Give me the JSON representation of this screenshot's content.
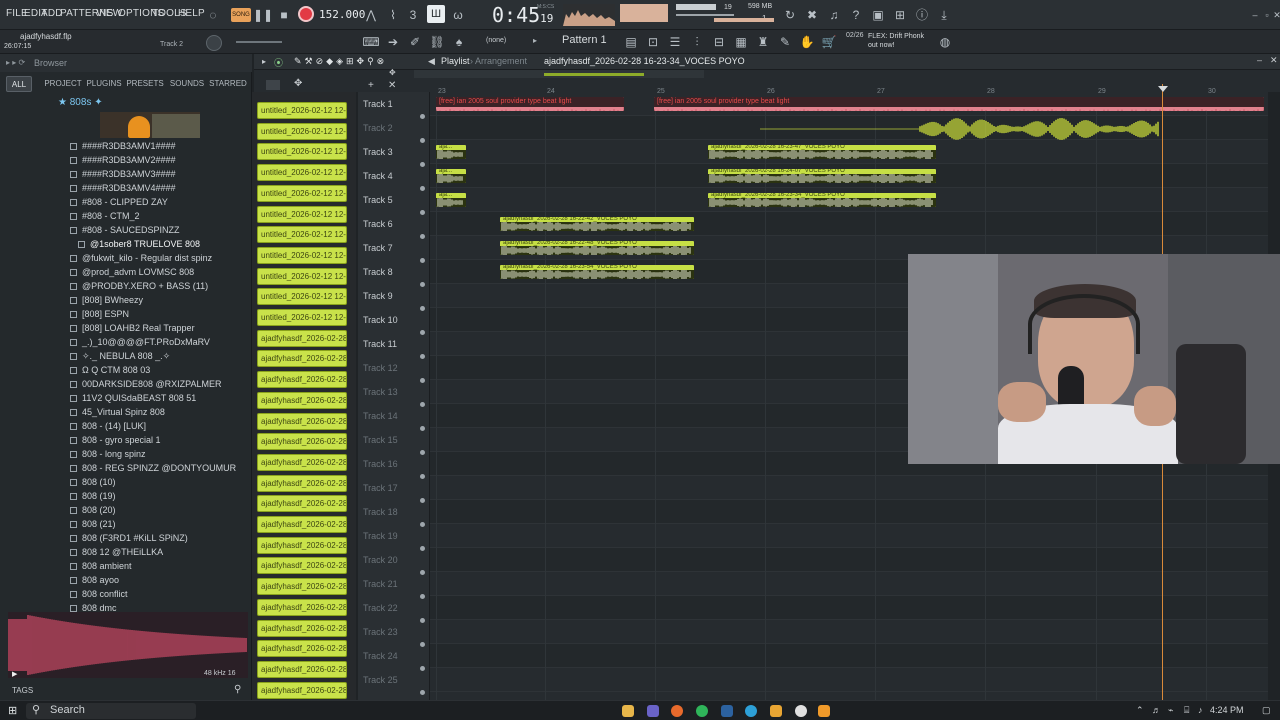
{
  "menu": [
    "FILE",
    "EDIT",
    "ADD",
    "PATTERNS",
    "VIEW",
    "OPTIONS",
    "TOOLS",
    "HELP"
  ],
  "transport": {
    "mode": "SONG",
    "tempo": "152.000",
    "time_main": "0:45",
    "time_sub": "19",
    "time_label": "M:S:CS",
    "memory": "598 MB",
    "cpu": "19",
    "voices": "1"
  },
  "project": {
    "filename": "ajadfyhasdf.flp",
    "elapsed": "26:07:15",
    "hint_track": "Track 2"
  },
  "bar2": {
    "pattern_label": "Pattern 1",
    "none_label": "(none)",
    "news_date": "02/26",
    "news_text": "FLEX: Drift Phonk out now!"
  },
  "browser": {
    "title": "Browser",
    "tabs": [
      "ALL",
      "PROJECT",
      "PLUGINS",
      "PRESETS",
      "SOUNDS",
      "STARRED"
    ],
    "folder": "808s",
    "items": [
      "####R3DB3AMV1####",
      "####R3DB3AMV2####",
      "####R3DB3AMV3####",
      "####R3DB3AMV4####",
      "#808 - CLIPPED ZAY",
      "#808 - CTM_2",
      "#808 - SAUCEDSPINZZ",
      "@1sober8 TRUELOVE 808",
      "@fukwit_kilo - Regular dist spinz",
      "@prod_advm LOVMSC 808",
      "@PRODBY.XERO + BASS (11)",
      "[808] BWheezy",
      "[808] ESPN",
      "[808] LOAHB2 Real Trapper",
      "_.)_10@@@@FT.PRoDxMaRV",
      "✧._ NEBULA 808 _.✧",
      "Ω Q CTM 808 03",
      "00DARKSIDE808 @RXIZPALMER",
      "11V2 QUISdaBEAST 808 51",
      "45_Virtual Spinz 808",
      "808 - (14) [LUK]",
      "808 - gyro special 1",
      "808 - long spinz",
      "808 - REG SPINZZ @DONTYOUMUR",
      "808 (10)",
      "808 (19)",
      "808 (20)",
      "808 (21)",
      "808 (F3RD1 #KiLL SPiNZ)",
      "808 12 @THEiLLKA",
      "808 ambient",
      "808 ayoo",
      "808 conflict",
      "808 dmc"
    ],
    "sample_info": "48 kHz 16",
    "tags_label": "TAGS"
  },
  "picker": {
    "untitled": "untitled_2026-02-12 12-...",
    "ajad": "ajadfyhasdf_2026-02-28..."
  },
  "playlist": {
    "title": "Playlist",
    "subtitle": "Arrangement",
    "pattern": "ajadfyhasdf_2026-02-28 16-23-34_VOCES POYO",
    "bars": [
      "23",
      "24",
      "25",
      "26",
      "27",
      "28",
      "29",
      "30"
    ],
    "tracks": [
      "Track 1",
      "Track 2",
      "Track 3",
      "Track 4",
      "Track 5",
      "Track 6",
      "Track 7",
      "Track 8",
      "Track 9",
      "Track 10",
      "Track 11",
      "Track 12",
      "Track 13",
      "Track 14",
      "Track 15",
      "Track 16",
      "Track 17",
      "Track 18",
      "Track 19",
      "Track 20",
      "Track 21",
      "Track 22",
      "Track 23",
      "Track 24",
      "Track 25"
    ],
    "beat_clip": "[free] ian  2005  soul provider type beat light",
    "short_clip": "aja...",
    "clips_r3": "ajadfyhasdf_2026-02-28 16-23-47_VOCES POYO",
    "clips_r4": "ajadfyhasdf_2026-02-28 16-24-07_VOCES POYO",
    "clips_r5": "ajadfyhasdf_2026-02-28 16-23-34_VOCES POYO",
    "clips_r6": "ajadfyhasdf_2026-02-28 16-22-42_VOCES POYO",
    "clips_r7": "ajadfyhasdf_2026-02-28 16-22-48_VOCES POYO",
    "clips_r8": "ajadfyhasdf_2026-02-28 16-23-54_VOCES POYO"
  },
  "taskbar": {
    "search": "Search",
    "time": "4:24 PM"
  }
}
